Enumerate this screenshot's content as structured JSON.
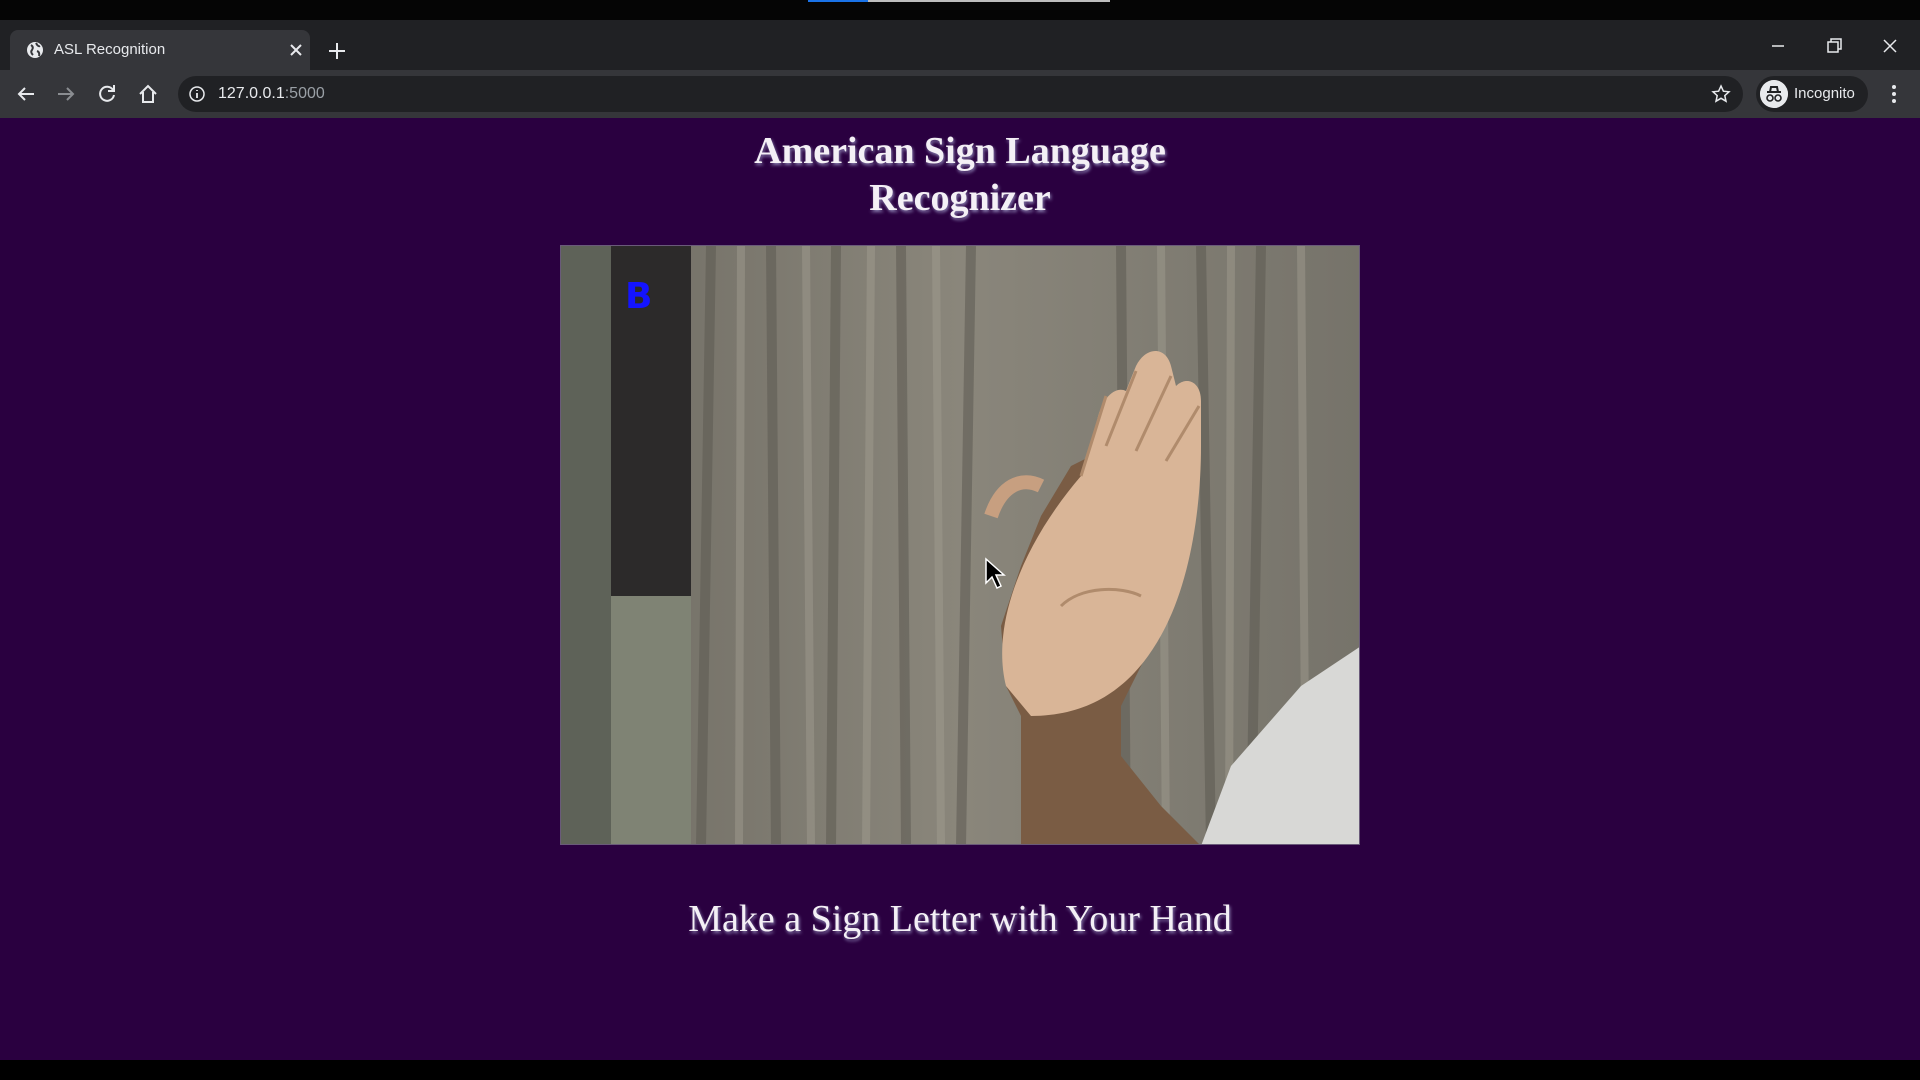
{
  "browser": {
    "tab": {
      "title": "ASL Recognition",
      "icon": "globe-icon"
    },
    "address": {
      "host": "127.0.0.1",
      "port": ":5000"
    },
    "profile": {
      "label": "Incognito",
      "icon": "incognito-icon"
    },
    "colors": {
      "tabstrip": "#202124",
      "toolbar": "#35363a"
    }
  },
  "page": {
    "heading_line1": "American Sign Language",
    "heading_line2": "Recognizer",
    "predicted_letter": "B",
    "instruction": "Make a Sign Letter with Your Hand",
    "background_color": "#2a0040"
  }
}
